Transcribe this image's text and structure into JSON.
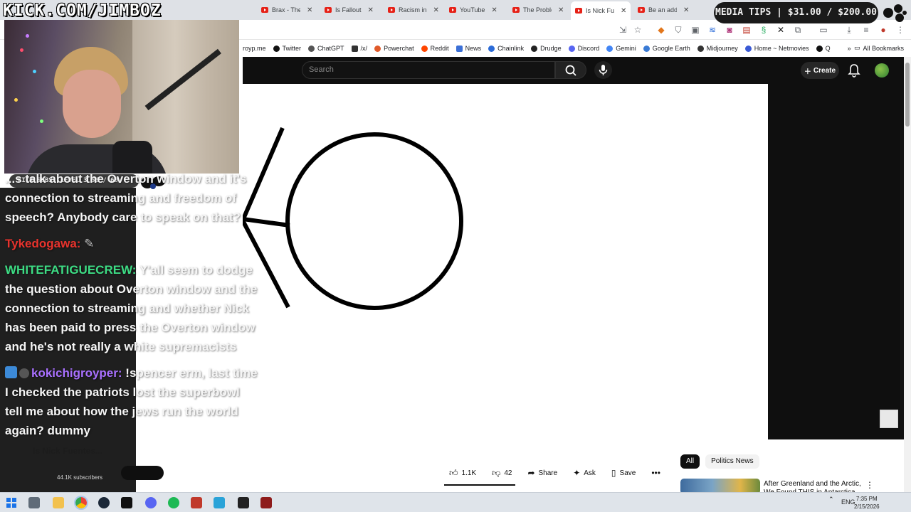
{
  "stream": {
    "watermark": "KICK.COM/JIMBOZ",
    "media_tips": "MEDIA TIPS | $31.00 / $200.00",
    "subs_bar": "KICK SUBS: LEVEL 3 56 / 60"
  },
  "tabs": [
    {
      "label": "Brax - The"
    },
    {
      "label": "Is Fallout"
    },
    {
      "label": "Racism in"
    },
    {
      "label": "YouTube"
    },
    {
      "label": "The Proble"
    },
    {
      "label": "Is Nick Fue"
    },
    {
      "label": "Be an add"
    }
  ],
  "bookmarks": [
    {
      "label": "royp.me",
      "color": "#888888"
    },
    {
      "label": "Twitter",
      "color": "#111111"
    },
    {
      "label": "ChatGPT",
      "color": "#555555"
    },
    {
      "label": "/x/",
      "color": "#333333"
    },
    {
      "label": "Powerchat",
      "color": "#e05a2a"
    },
    {
      "label": "Reddit",
      "color": "#ff4500"
    },
    {
      "label": "News",
      "color": "#3b6fd6"
    },
    {
      "label": "Chainlink",
      "color": "#2b6bd8"
    },
    {
      "label": "Drudge",
      "color": "#222222"
    },
    {
      "label": "Discord",
      "color": "#5865f2"
    },
    {
      "label": "Gemini",
      "color": "#4285f4"
    },
    {
      "label": "Google Earth",
      "color": "#3a7bd5"
    },
    {
      "label": "Midjourney",
      "color": "#333333"
    },
    {
      "label": "Home ~ Netmovies",
      "color": "#3a5ad5"
    },
    {
      "label": "Q",
      "color": "#111111"
    }
  ],
  "bookmarks_all": "All Bookmarks",
  "youtube": {
    "search_placeholder": "Search",
    "create_label": "Create",
    "likes": "1.1K",
    "dislikes": "42",
    "share": "Share",
    "ask": "Ask",
    "save": "Save",
    "chips": [
      "All",
      "Politics News"
    ],
    "rec_title": "After Greenland and the Arctic, We Found THIS in Antarctica",
    "channel_subs": "44.1K subscribers",
    "video_title_fragment": "Is Nick Fuentes..."
  },
  "chat": [
    {
      "user": "",
      "text": "...s talk about the Overton window and it's connection to streaming and freedom of speech? Anybody care to speak on that?"
    },
    {
      "user": "Tykedogawa:",
      "text": ""
    },
    {
      "user": "WHITEFATIGUECREW:",
      "text": "Y'all seem to dodge the question about Overton window and the connection to streaming and whether Nick has been paid to press the Overton window and he's not really a white supremacists"
    },
    {
      "user": "kokichigroyper:",
      "text": "!spencer erm, last time I checked the patriots lost the superbowl tell me about how the jews run the world again? dummy"
    }
  ],
  "taskbar": {
    "lang": "ENG",
    "time": "7:35 PM",
    "date": "2/15/2026"
  },
  "colors": {
    "yt_header": "#0f0f0f",
    "chat_user_red": "#e8332d",
    "chat_user_green": "#3ddc84",
    "chat_user_purple": "#a970ff"
  }
}
